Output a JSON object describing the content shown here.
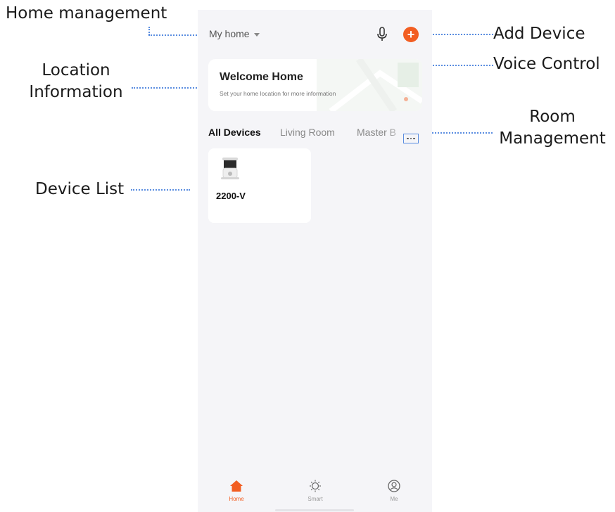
{
  "app": {
    "home_selector": "My home",
    "welcome_title": "Welcome Home",
    "welcome_subtitle": "Set your home location for more information",
    "tabs": [
      "All Devices",
      "Living Room",
      "Master B"
    ],
    "device": {
      "name": "2200-V",
      "icon": "feeder-device-image"
    },
    "nav": [
      {
        "label": "Home",
        "icon": "home-icon",
        "active": true
      },
      {
        "label": "Smart",
        "icon": "sun-icon",
        "active": false
      },
      {
        "label": "Me",
        "icon": "profile-icon",
        "active": false
      }
    ],
    "accent_color": "#f25e22"
  },
  "annotations": {
    "home_management": "Home management",
    "location_information": "Location Information",
    "device_list": "Device List",
    "add_device": "Add Device",
    "voice_control": "Voice Control",
    "room_management": "Room Management"
  }
}
